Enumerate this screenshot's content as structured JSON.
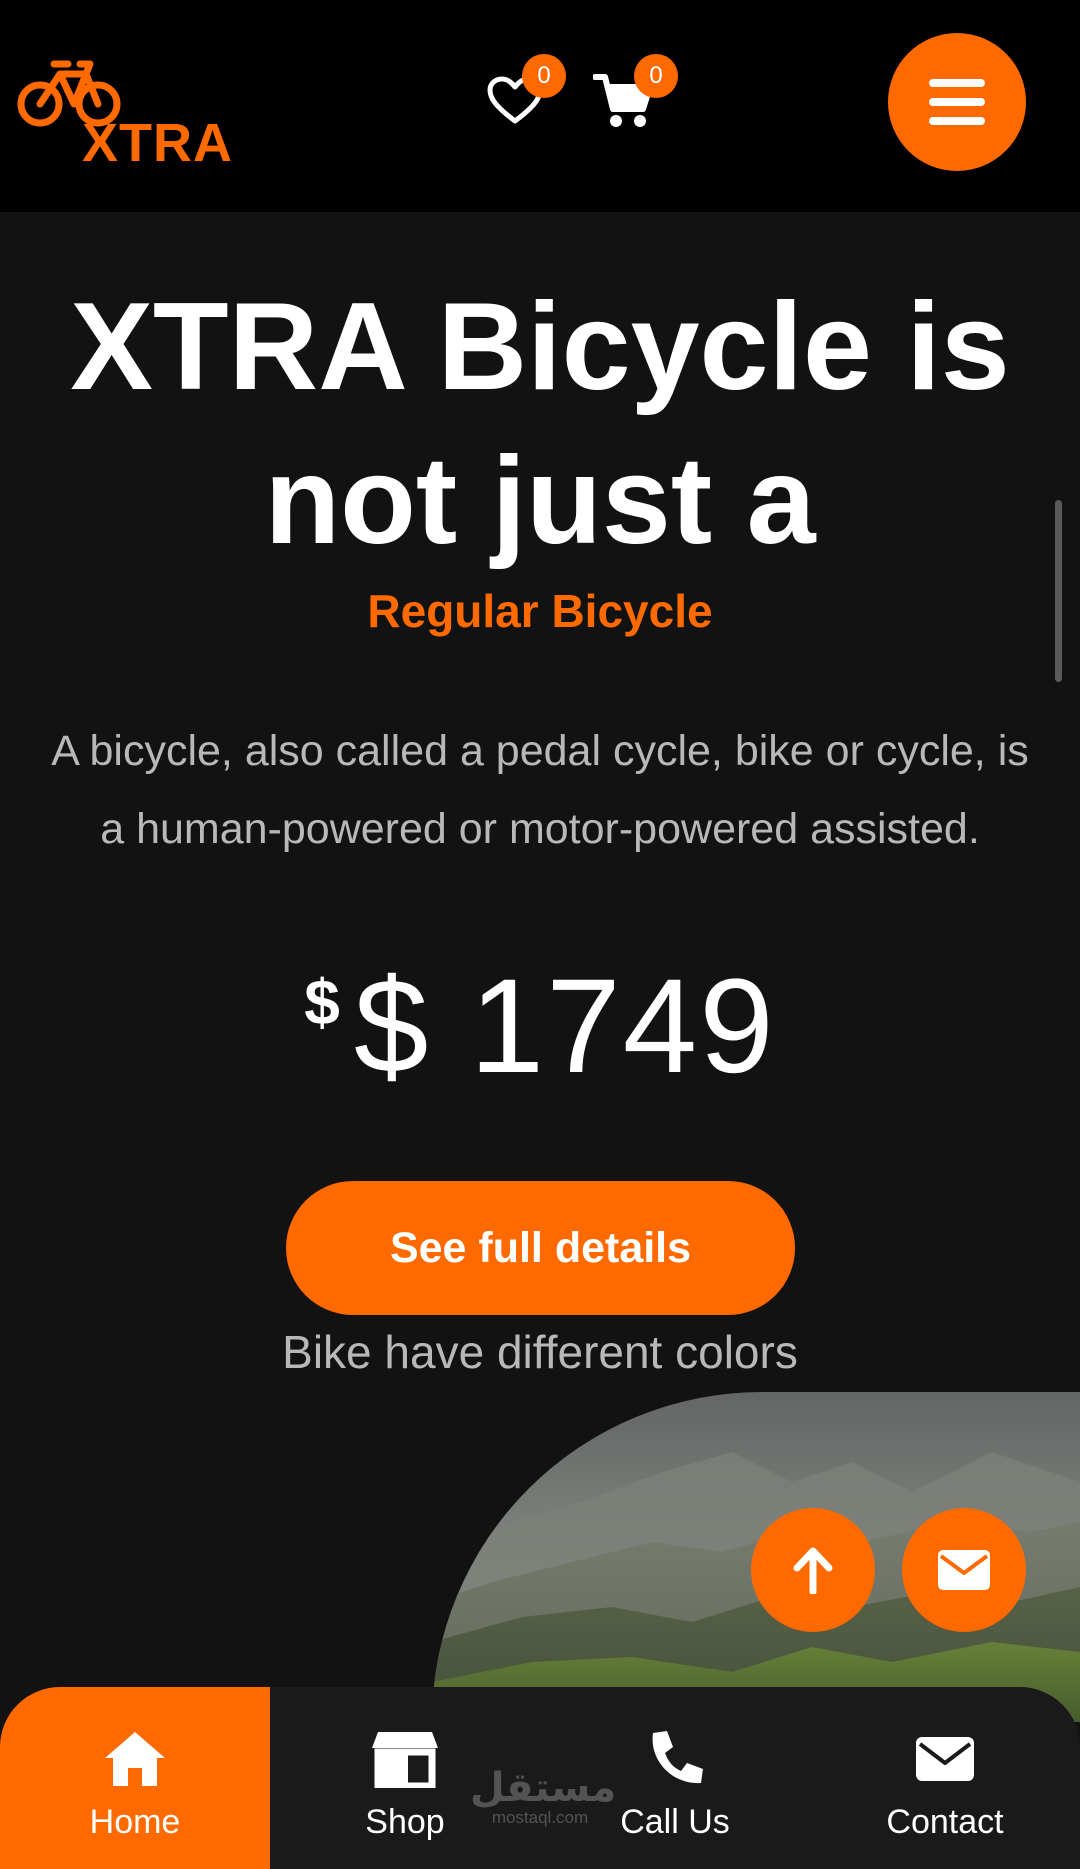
{
  "header": {
    "logo_text": "XTRA",
    "wishlist_count": "0",
    "cart_count": "0"
  },
  "hero": {
    "title_line1": "XTRA Bicycle is",
    "title_line2": "not just a",
    "subtitle": "Regular Bicycle",
    "description_line1": "A bicycle, also called a pedal cycle, bike or cycle, is",
    "description_line2": "a human-powered or motor-powered assisted.",
    "price_currency_symbol": "$",
    "price_value": "$ 1749",
    "cta_label": "See full details",
    "colors_note": "Bike have different colors"
  },
  "watermark": {
    "arabic": "مستقل",
    "latin": "mostaql.com"
  },
  "bottom_nav": {
    "items": [
      {
        "label": "Home",
        "icon": "home-icon",
        "active": true
      },
      {
        "label": "Shop",
        "icon": "shop-icon",
        "active": false
      },
      {
        "label": "Call Us",
        "icon": "phone-icon",
        "active": false
      },
      {
        "label": "Contact",
        "icon": "mail-icon",
        "active": false
      }
    ]
  },
  "colors": {
    "accent": "#ff6a00",
    "background": "#121212",
    "header_background": "#000000",
    "nav_background": "#1a1a1a",
    "muted_text": "#b8b8b8"
  }
}
